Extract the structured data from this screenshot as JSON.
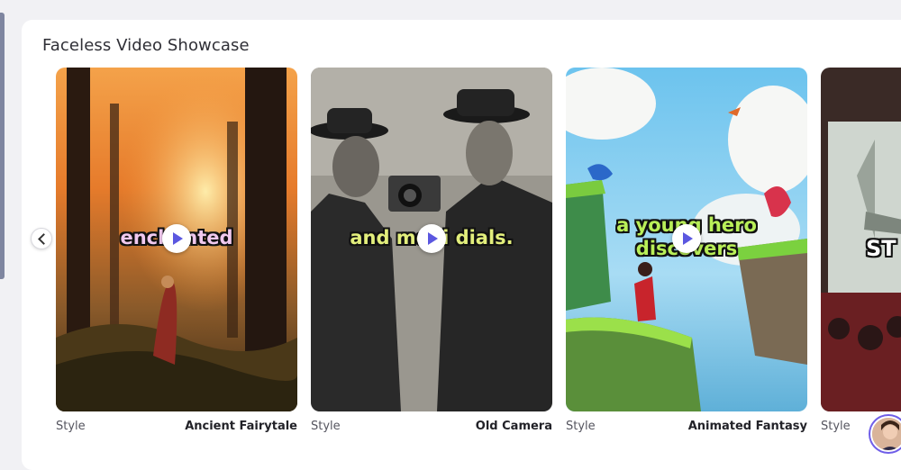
{
  "section": {
    "title": "Faceless Video Showcase"
  },
  "cards": [
    {
      "caption": "enchanted",
      "style_label": "Style",
      "style_value": "Ancient Fairytale"
    },
    {
      "caption": "and moni dials.",
      "style_label": "Style",
      "style_value": "Old Camera"
    },
    {
      "caption": "a young hero discovers",
      "style_label": "Style",
      "style_value": "Animated Fantasy"
    },
    {
      "caption": "ST",
      "style_label": "Style",
      "style_value": ""
    }
  ],
  "icons": {
    "prev": "chevron-left-icon",
    "play": "play-icon",
    "avatar": "user-avatar"
  },
  "colors": {
    "play_accent": "#5b57e0",
    "avatar_ring": "#6f5ee8"
  }
}
